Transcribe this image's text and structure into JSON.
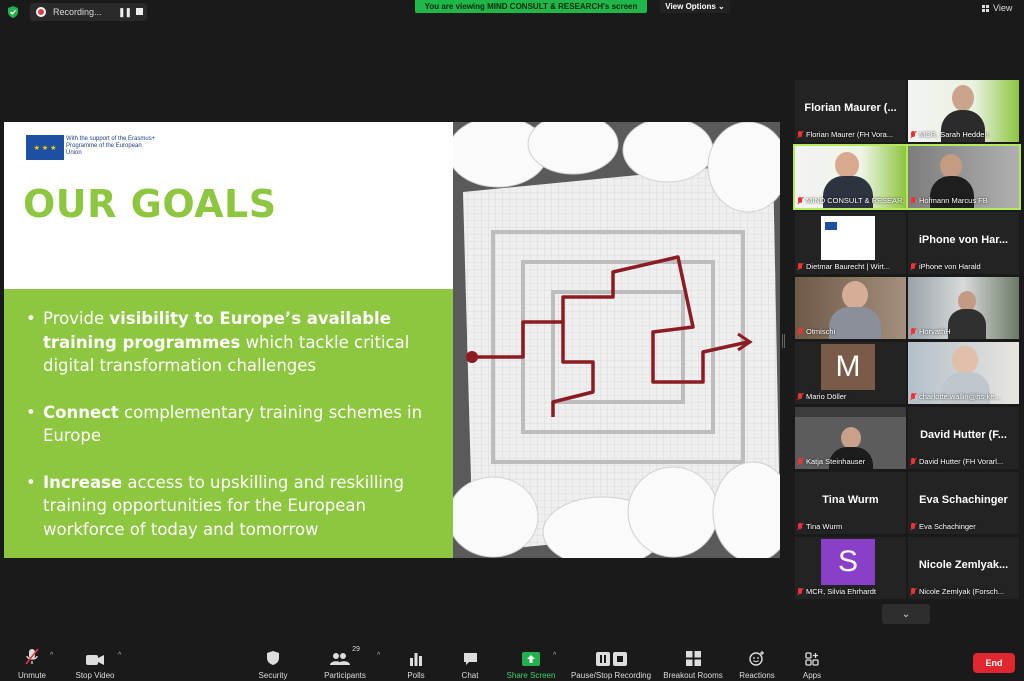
{
  "topbar": {
    "recording_label": "Recording...",
    "pause_glyph": "❚❚",
    "viewing_banner": "You are viewing MIND CONSULT & RESEARCH's screen",
    "view_options_label": "View Options ⌄",
    "view_label": "View"
  },
  "slide": {
    "eu_text": "With the support of the Erasmus+ Programme of the European Union",
    "eu_stars": "★ ★ ★",
    "title": "OUR GOALS",
    "bullets": [
      {
        "pre": "Provide ",
        "bold": "visibility to Europe’s available training programmes",
        "post": " which tackle critical digital transformation challenges"
      },
      {
        "pre": "",
        "bold": "Connect",
        "post": " complementary training schemes in Europe"
      },
      {
        "pre": "",
        "bold": "Increase",
        "post": " access to upskilling and reskilling training opportunities for the European workforce of today and tomorrow"
      }
    ]
  },
  "gallery": {
    "tiles": [
      {
        "name": "Florian Maurer (...",
        "label": "Florian Maurer (FH Vora..."
      },
      {
        "name": "",
        "label": "MCR, Sarah Hedden"
      },
      {
        "name": "",
        "label": "MIND CONSULT & RESEAR..."
      },
      {
        "name": "",
        "label": "Hofmann Marcus FB"
      },
      {
        "name": "",
        "label": "Dietmar Baurecht | Wirt..."
      },
      {
        "name": "iPhone von Har...",
        "label": "iPhone von Harald"
      },
      {
        "name": "",
        "label": "Otmischi"
      },
      {
        "name": "",
        "label": "HorvathH"
      },
      {
        "name": "M",
        "label": "Mario Döller"
      },
      {
        "name": "",
        "label": "charlotte.wallin@hs-ke..."
      },
      {
        "name": "",
        "label": "Katja Steinhauser"
      },
      {
        "name": "David Hutter (F...",
        "label": "David Hutter (FH Vorarl..."
      },
      {
        "name": "Tina Wurm",
        "label": "Tina Wurm"
      },
      {
        "name": "Eva Schachinger",
        "label": "Eva Schachinger"
      },
      {
        "name": "S",
        "label": "MCR, Silvia Ehrhardt"
      },
      {
        "name": "Nicole Zemlyak...",
        "label": "Nicole Zemlyak (Forsch..."
      }
    ],
    "down_glyph": "⌄"
  },
  "toolbar": {
    "unmute": "Unmute",
    "stop_video": "Stop Video",
    "security": "Security",
    "participants": "Participants",
    "participants_count": "29",
    "polls": "Polls",
    "chat": "Chat",
    "share_screen": "Share Screen",
    "recording": "Pause/Stop Recording",
    "breakout": "Breakout Rooms",
    "reactions": "Reactions",
    "apps": "Apps",
    "end": "End",
    "caret": "^"
  },
  "colors": {
    "accent_green": "#8dc63f",
    "banner_green": "#1fb74a",
    "end_red": "#e0262e",
    "active_speaker": "#b6e85b"
  }
}
